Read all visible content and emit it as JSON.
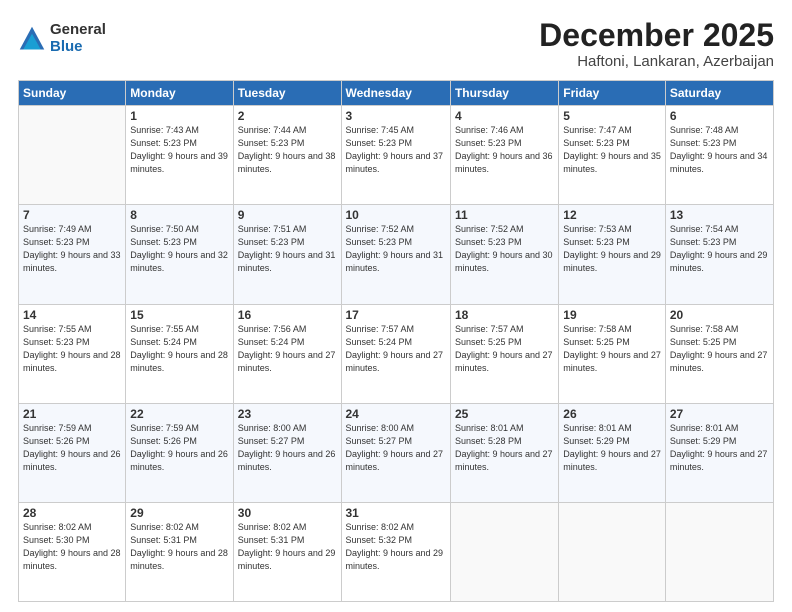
{
  "logo": {
    "general": "General",
    "blue": "Blue"
  },
  "header": {
    "month": "December 2025",
    "location": "Haftoni, Lankaran, Azerbaijan"
  },
  "weekdays": [
    "Sunday",
    "Monday",
    "Tuesday",
    "Wednesday",
    "Thursday",
    "Friday",
    "Saturday"
  ],
  "weeks": [
    [
      {
        "day": "",
        "sunrise": "",
        "sunset": "",
        "daylight": ""
      },
      {
        "day": "1",
        "sunrise": "Sunrise: 7:43 AM",
        "sunset": "Sunset: 5:23 PM",
        "daylight": "Daylight: 9 hours and 39 minutes."
      },
      {
        "day": "2",
        "sunrise": "Sunrise: 7:44 AM",
        "sunset": "Sunset: 5:23 PM",
        "daylight": "Daylight: 9 hours and 38 minutes."
      },
      {
        "day": "3",
        "sunrise": "Sunrise: 7:45 AM",
        "sunset": "Sunset: 5:23 PM",
        "daylight": "Daylight: 9 hours and 37 minutes."
      },
      {
        "day": "4",
        "sunrise": "Sunrise: 7:46 AM",
        "sunset": "Sunset: 5:23 PM",
        "daylight": "Daylight: 9 hours and 36 minutes."
      },
      {
        "day": "5",
        "sunrise": "Sunrise: 7:47 AM",
        "sunset": "Sunset: 5:23 PM",
        "daylight": "Daylight: 9 hours and 35 minutes."
      },
      {
        "day": "6",
        "sunrise": "Sunrise: 7:48 AM",
        "sunset": "Sunset: 5:23 PM",
        "daylight": "Daylight: 9 hours and 34 minutes."
      }
    ],
    [
      {
        "day": "7",
        "sunrise": "Sunrise: 7:49 AM",
        "sunset": "Sunset: 5:23 PM",
        "daylight": "Daylight: 9 hours and 33 minutes."
      },
      {
        "day": "8",
        "sunrise": "Sunrise: 7:50 AM",
        "sunset": "Sunset: 5:23 PM",
        "daylight": "Daylight: 9 hours and 32 minutes."
      },
      {
        "day": "9",
        "sunrise": "Sunrise: 7:51 AM",
        "sunset": "Sunset: 5:23 PM",
        "daylight": "Daylight: 9 hours and 31 minutes."
      },
      {
        "day": "10",
        "sunrise": "Sunrise: 7:52 AM",
        "sunset": "Sunset: 5:23 PM",
        "daylight": "Daylight: 9 hours and 31 minutes."
      },
      {
        "day": "11",
        "sunrise": "Sunrise: 7:52 AM",
        "sunset": "Sunset: 5:23 PM",
        "daylight": "Daylight: 9 hours and 30 minutes."
      },
      {
        "day": "12",
        "sunrise": "Sunrise: 7:53 AM",
        "sunset": "Sunset: 5:23 PM",
        "daylight": "Daylight: 9 hours and 29 minutes."
      },
      {
        "day": "13",
        "sunrise": "Sunrise: 7:54 AM",
        "sunset": "Sunset: 5:23 PM",
        "daylight": "Daylight: 9 hours and 29 minutes."
      }
    ],
    [
      {
        "day": "14",
        "sunrise": "Sunrise: 7:55 AM",
        "sunset": "Sunset: 5:23 PM",
        "daylight": "Daylight: 9 hours and 28 minutes."
      },
      {
        "day": "15",
        "sunrise": "Sunrise: 7:55 AM",
        "sunset": "Sunset: 5:24 PM",
        "daylight": "Daylight: 9 hours and 28 minutes."
      },
      {
        "day": "16",
        "sunrise": "Sunrise: 7:56 AM",
        "sunset": "Sunset: 5:24 PM",
        "daylight": "Daylight: 9 hours and 27 minutes."
      },
      {
        "day": "17",
        "sunrise": "Sunrise: 7:57 AM",
        "sunset": "Sunset: 5:24 PM",
        "daylight": "Daylight: 9 hours and 27 minutes."
      },
      {
        "day": "18",
        "sunrise": "Sunrise: 7:57 AM",
        "sunset": "Sunset: 5:25 PM",
        "daylight": "Daylight: 9 hours and 27 minutes."
      },
      {
        "day": "19",
        "sunrise": "Sunrise: 7:58 AM",
        "sunset": "Sunset: 5:25 PM",
        "daylight": "Daylight: 9 hours and 27 minutes."
      },
      {
        "day": "20",
        "sunrise": "Sunrise: 7:58 AM",
        "sunset": "Sunset: 5:25 PM",
        "daylight": "Daylight: 9 hours and 27 minutes."
      }
    ],
    [
      {
        "day": "21",
        "sunrise": "Sunrise: 7:59 AM",
        "sunset": "Sunset: 5:26 PM",
        "daylight": "Daylight: 9 hours and 26 minutes."
      },
      {
        "day": "22",
        "sunrise": "Sunrise: 7:59 AM",
        "sunset": "Sunset: 5:26 PM",
        "daylight": "Daylight: 9 hours and 26 minutes."
      },
      {
        "day": "23",
        "sunrise": "Sunrise: 8:00 AM",
        "sunset": "Sunset: 5:27 PM",
        "daylight": "Daylight: 9 hours and 26 minutes."
      },
      {
        "day": "24",
        "sunrise": "Sunrise: 8:00 AM",
        "sunset": "Sunset: 5:27 PM",
        "daylight": "Daylight: 9 hours and 27 minutes."
      },
      {
        "day": "25",
        "sunrise": "Sunrise: 8:01 AM",
        "sunset": "Sunset: 5:28 PM",
        "daylight": "Daylight: 9 hours and 27 minutes."
      },
      {
        "day": "26",
        "sunrise": "Sunrise: 8:01 AM",
        "sunset": "Sunset: 5:29 PM",
        "daylight": "Daylight: 9 hours and 27 minutes."
      },
      {
        "day": "27",
        "sunrise": "Sunrise: 8:01 AM",
        "sunset": "Sunset: 5:29 PM",
        "daylight": "Daylight: 9 hours and 27 minutes."
      }
    ],
    [
      {
        "day": "28",
        "sunrise": "Sunrise: 8:02 AM",
        "sunset": "Sunset: 5:30 PM",
        "daylight": "Daylight: 9 hours and 28 minutes."
      },
      {
        "day": "29",
        "sunrise": "Sunrise: 8:02 AM",
        "sunset": "Sunset: 5:31 PM",
        "daylight": "Daylight: 9 hours and 28 minutes."
      },
      {
        "day": "30",
        "sunrise": "Sunrise: 8:02 AM",
        "sunset": "Sunset: 5:31 PM",
        "daylight": "Daylight: 9 hours and 29 minutes."
      },
      {
        "day": "31",
        "sunrise": "Sunrise: 8:02 AM",
        "sunset": "Sunset: 5:32 PM",
        "daylight": "Daylight: 9 hours and 29 minutes."
      },
      {
        "day": "",
        "sunrise": "",
        "sunset": "",
        "daylight": ""
      },
      {
        "day": "",
        "sunrise": "",
        "sunset": "",
        "daylight": ""
      },
      {
        "day": "",
        "sunrise": "",
        "sunset": "",
        "daylight": ""
      }
    ]
  ]
}
